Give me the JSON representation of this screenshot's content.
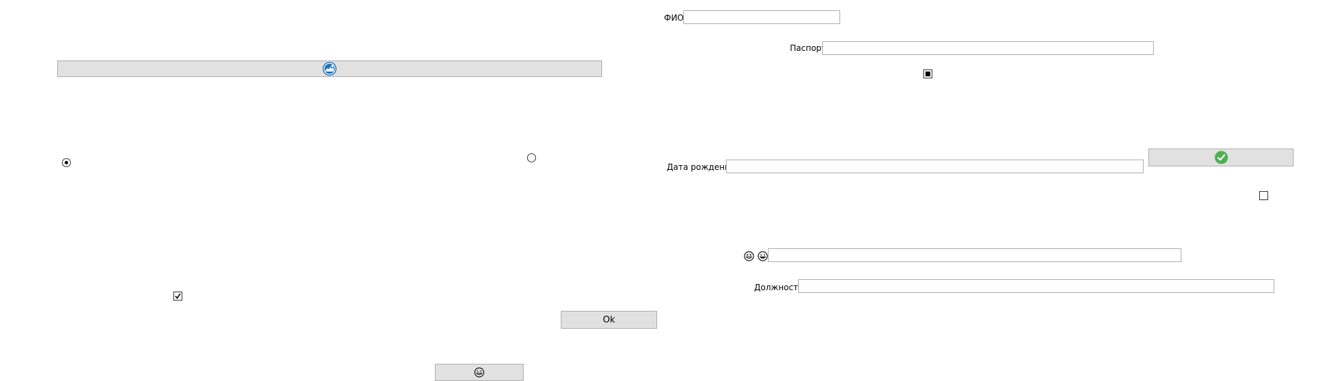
{
  "labels": {
    "fio": "ФИО",
    "passport": "Паспорт",
    "birth_date": "Дата рождения",
    "position": "Должность"
  },
  "buttons": {
    "ok_label": "Ok",
    "top_icon": "blue-circle-logo-icon",
    "confirm_icon": "green-check-circle-icon",
    "bottom_icon": "emoji-face-icon"
  },
  "fields": {
    "fio_value": "",
    "passport_value": "",
    "birth_date_value": "",
    "emoji_field_value": "",
    "position_value": ""
  },
  "emoji_prefix_icons": [
    "laughing-face-icon",
    "grinning-face-icon"
  ],
  "radios": [
    {
      "name": "radio-left",
      "checked": true
    },
    {
      "name": "radio-right",
      "checked": false
    }
  ],
  "checkboxes": [
    {
      "name": "checkbox-top",
      "state": "indeterminate"
    },
    {
      "name": "checkbox-right",
      "state": "unchecked"
    },
    {
      "name": "checkbox-bottom",
      "state": "checked"
    }
  ],
  "colors": {
    "button_bg": "#e1e1e1",
    "button_border": "#adadad",
    "field_border": "#abadb3",
    "logo_blue": "#1e73be",
    "check_green": "#4caf50"
  }
}
